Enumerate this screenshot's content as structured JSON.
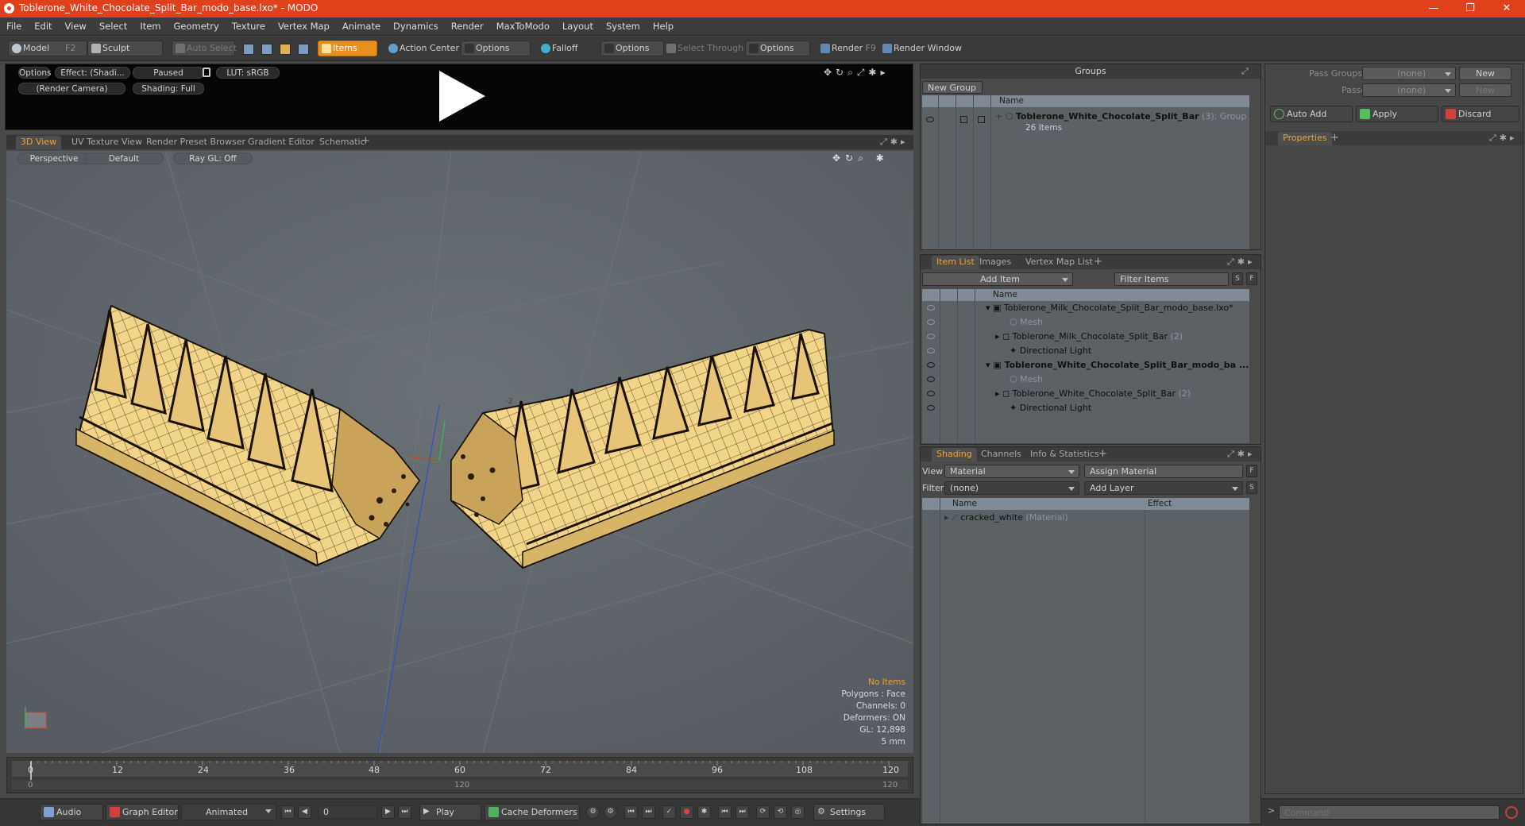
{
  "window": {
    "title": "Toblerone_White_Chocolate_Split_Bar_modo_base.lxo* - MODO",
    "minimize": "—",
    "restore": "❐",
    "close": "✕"
  },
  "menu": [
    "File",
    "Edit",
    "View",
    "Select",
    "Item",
    "Geometry",
    "Texture",
    "Vertex Map",
    "Animate",
    "Dynamics",
    "Render",
    "MaxToModo",
    "Layout",
    "System",
    "Help"
  ],
  "toolbar": {
    "model": "Model",
    "model_key": "F2",
    "sculpt": "Sculpt",
    "auto_select": "Auto Select",
    "items": "Items",
    "action_center": "Action Center",
    "options1": "Options",
    "falloff": "Falloff",
    "options2": "Options",
    "select_through": "Select Through",
    "options3": "Options",
    "render": "Render",
    "render_key": "F9",
    "render_window": "Render Window"
  },
  "preview": {
    "options": "Options",
    "effect": "Effect: (Shadi...",
    "paused": "Paused",
    "lut": "LUT: sRGB",
    "camera": "(Render Camera)",
    "shading": "Shading: Full"
  },
  "viewport_tabs": [
    "3D View",
    "UV Texture View",
    "Render Preset Browser",
    "Gradient Editor",
    "Schematic"
  ],
  "viewport": {
    "perspective": "Perspective",
    "default": "Default",
    "raygl": "Ray GL: Off",
    "axis_label": "-2",
    "stats": {
      "no_items": "No Items",
      "polygons": "Polygons : Face",
      "channels": "Channels: 0",
      "deformers": "Deformers: ON",
      "gl": "GL: 12,898",
      "unit": "5 mm"
    }
  },
  "timeline": {
    "ticks": [
      "0",
      "12",
      "24",
      "36",
      "48",
      "60",
      "72",
      "84",
      "96",
      "108",
      "120"
    ],
    "sub_start": "0",
    "sub_mid": "120",
    "sub_end": "120"
  },
  "bottom": {
    "audio": "Audio",
    "graph_editor": "Graph Editor",
    "animated": "Animated",
    "frame": "0",
    "play": "Play",
    "cache": "Cache Deformers",
    "settings": "Settings",
    "command_placeholder": "Command"
  },
  "groups": {
    "header": "Groups",
    "new_group": "New Group",
    "col_name": "Name",
    "item_name": "Toblerone_White_Chocolate_Split_Bar",
    "item_count": "(3)",
    "item_type": ": Group",
    "item_sub": "26 Items"
  },
  "pass_groups": {
    "pass_label": "Pass Groups",
    "pass_value": "(none)",
    "new1": "New",
    "passes_label": "Passes",
    "passes_value": "(none)",
    "new2": "New"
  },
  "actions": {
    "auto_add": "Auto Add",
    "apply": "Apply",
    "discard": "Discard"
  },
  "properties": {
    "tab": "Properties"
  },
  "itemlist": {
    "tabs": [
      "Item List",
      "Images",
      "Vertex Map List"
    ],
    "add_item": "Add Item",
    "filter": "Filter Items",
    "s": "S",
    "f": "F",
    "col_name": "Name",
    "items": [
      {
        "label": "Toblerone_Milk_Chocolate_Split_Bar_modo_base.lxo*",
        "count": ""
      },
      {
        "label": "Mesh",
        "count": ""
      },
      {
        "label": "Toblerone_Milk_Chocolate_Split_Bar",
        "count": "(2)"
      },
      {
        "label": "Directional Light",
        "count": ""
      },
      {
        "label": "Toblerone_White_Chocolate_Split_Bar_modo_ba ...",
        "count": ""
      },
      {
        "label": "Mesh",
        "count": ""
      },
      {
        "label": "Toblerone_White_Chocolate_Split_Bar",
        "count": "(2)"
      },
      {
        "label": "Directional Light",
        "count": ""
      }
    ]
  },
  "shading": {
    "tabs": [
      "Shading",
      "Channels",
      "Info & Statistics"
    ],
    "view_label": "View",
    "view_value": "Material",
    "assign": "Assign Material",
    "f": "F",
    "filter_label": "Filter",
    "filter_value": "(none)",
    "add_layer": "Add Layer",
    "s": "S",
    "col_name": "Name",
    "col_effect": "Effect",
    "material": "cracked_white",
    "material_type": "(Material)"
  },
  "colors": {
    "accent": "#f0a030",
    "title": "#e0401a",
    "chocolate": "#f2d488"
  }
}
